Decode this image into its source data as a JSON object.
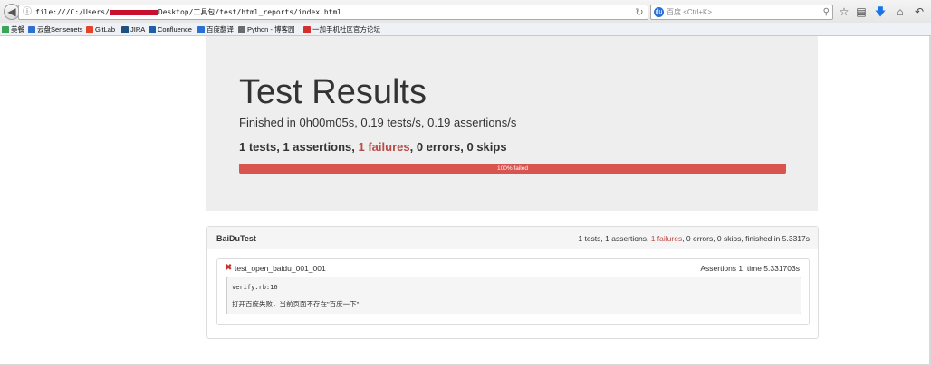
{
  "browser": {
    "url_prefix": "file:///C:/Users/",
    "url_suffix": "Desktop/工具包/test/html_reports/index.html",
    "search_placeholder": "百度 <Ctrl+K>"
  },
  "bookmarks": [
    {
      "label": "美餐",
      "color": "#3aa655"
    },
    {
      "label": "云盘Sensenets",
      "color": "#2f6fcf"
    },
    {
      "label": "GitLab",
      "color": "#e2432a"
    },
    {
      "label": "JIRA",
      "color": "#205081"
    },
    {
      "label": "Confluence",
      "color": "#1f5fa8"
    },
    {
      "label": "百度翻译",
      "color": "#2a6fd6"
    },
    {
      "label": "Python - 博客园",
      "color": "#6b6b6b"
    },
    {
      "label": "一加手机社区官方论坛",
      "color": "#d32f2f"
    }
  ],
  "report": {
    "title": "Test Results",
    "finished": "Finished in 0h00m05s, 0.19 tests/s, 0.19 assertions/s",
    "summary_pre": "1 tests, 1 assertions, ",
    "summary_fail": "1 failures",
    "summary_post": ", 0 errors, 0 skips",
    "progress_label": "100% failed",
    "progress_fraction": 1.0
  },
  "suite": {
    "name": "BaiDuTest",
    "stats_pre": "1 tests, 1 assertions, ",
    "stats_fail": "1 failures",
    "stats_post": ", 0 errors, 0 skips, finished in 5.3317s",
    "test": {
      "name": "test_open_baidu_001_001",
      "meta": "Assertions 1, time 5.331703s",
      "error_location": "verify.rb:16",
      "error_message": "打开百度失败，当前页面不存在\"百度一下\""
    }
  }
}
